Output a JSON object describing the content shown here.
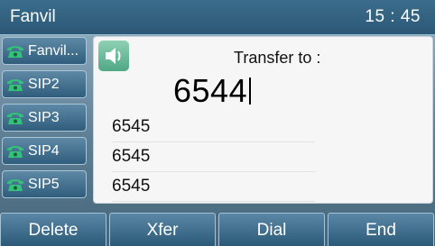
{
  "statusbar": {
    "title": "Fanvil",
    "time": "15 : 45"
  },
  "linekeys": [
    {
      "label": "Fanvil...",
      "icon": "phone-icon"
    },
    {
      "label": "SIP2",
      "icon": "phone-icon"
    },
    {
      "label": "SIP3",
      "icon": "phone-icon"
    },
    {
      "label": "SIP4",
      "icon": "phone-icon"
    },
    {
      "label": "SIP5",
      "icon": "phone-icon"
    }
  ],
  "panel": {
    "icon": "speaker-icon",
    "prompt": "Transfer to :",
    "number": "6544",
    "suggestions": [
      "6545",
      "6545",
      "6545"
    ]
  },
  "softkeys": [
    "Delete",
    "Xfer",
    "Dial",
    "End"
  ],
  "colors": {
    "accent": "#2c5875",
    "panel": "#f6f6f6",
    "speaker": "#4fa886"
  }
}
